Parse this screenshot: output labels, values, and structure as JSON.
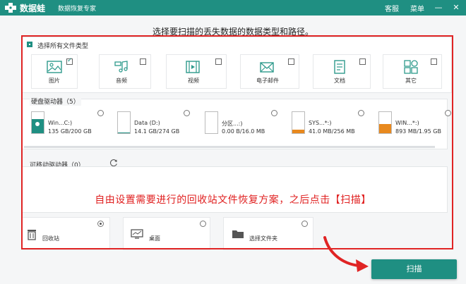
{
  "app": {
    "name": "数据蛙",
    "subtitle": "数据恢复专家"
  },
  "titlebar": {
    "service_label": "客服",
    "menu_label": "菜单",
    "minimize_glyph": "—",
    "close_glyph": "✕"
  },
  "heading": "选择要扫描的丢失数据的数据类型和路径。",
  "select_all": {
    "label": "选择所有文件类型"
  },
  "file_types": [
    {
      "label": "图片",
      "icon": "image-icon",
      "checked": true
    },
    {
      "label": "音频",
      "icon": "audio-icon",
      "checked": false
    },
    {
      "label": "视频",
      "icon": "video-icon",
      "checked": false
    },
    {
      "label": "电子邮件",
      "icon": "email-icon",
      "checked": false
    },
    {
      "label": "文档",
      "icon": "document-icon",
      "checked": false
    },
    {
      "label": "其它",
      "icon": "other-icon",
      "checked": false
    }
  ],
  "hard_drives": {
    "title": "硬盘驱动器（5）",
    "items": [
      {
        "name": "Win...C:)",
        "size": "135 GB/200 GB",
        "fill": 0.675,
        "color": "#1f8f82",
        "selected": false
      },
      {
        "name": "Data (D:)",
        "size": "14.1 GB/274 GB",
        "fill": 0.05,
        "color": "#1f8f82",
        "selected": false
      },
      {
        "name": "分区...:)",
        "size": "0.00  B/16.0 MB",
        "fill": 0.0,
        "color": "#e8891e",
        "selected": false
      },
      {
        "name": "SYS...*:)",
        "size": "41.0 MB/256 MB",
        "fill": 0.16,
        "color": "#e8891e",
        "selected": false
      },
      {
        "name": "WIN...*:)",
        "size": "893 MB/1.95 GB",
        "fill": 0.45,
        "color": "#e8891e",
        "selected": false
      }
    ]
  },
  "removable": {
    "title": "可移动驱动器（0）"
  },
  "annotation": "自由设置需要进行的回收站文件恢复方案，之后点击【扫描】",
  "locations": [
    {
      "label": "回收站",
      "icon": "recycle-bin-icon",
      "selected": true
    },
    {
      "label": "桌面",
      "icon": "desktop-icon",
      "selected": false
    },
    {
      "label": "选择文件夹",
      "icon": "folder-icon",
      "selected": false
    }
  ],
  "scan_button": {
    "label": "扫描"
  },
  "colors": {
    "accent": "#1f8f82",
    "highlight": "#e02424"
  }
}
